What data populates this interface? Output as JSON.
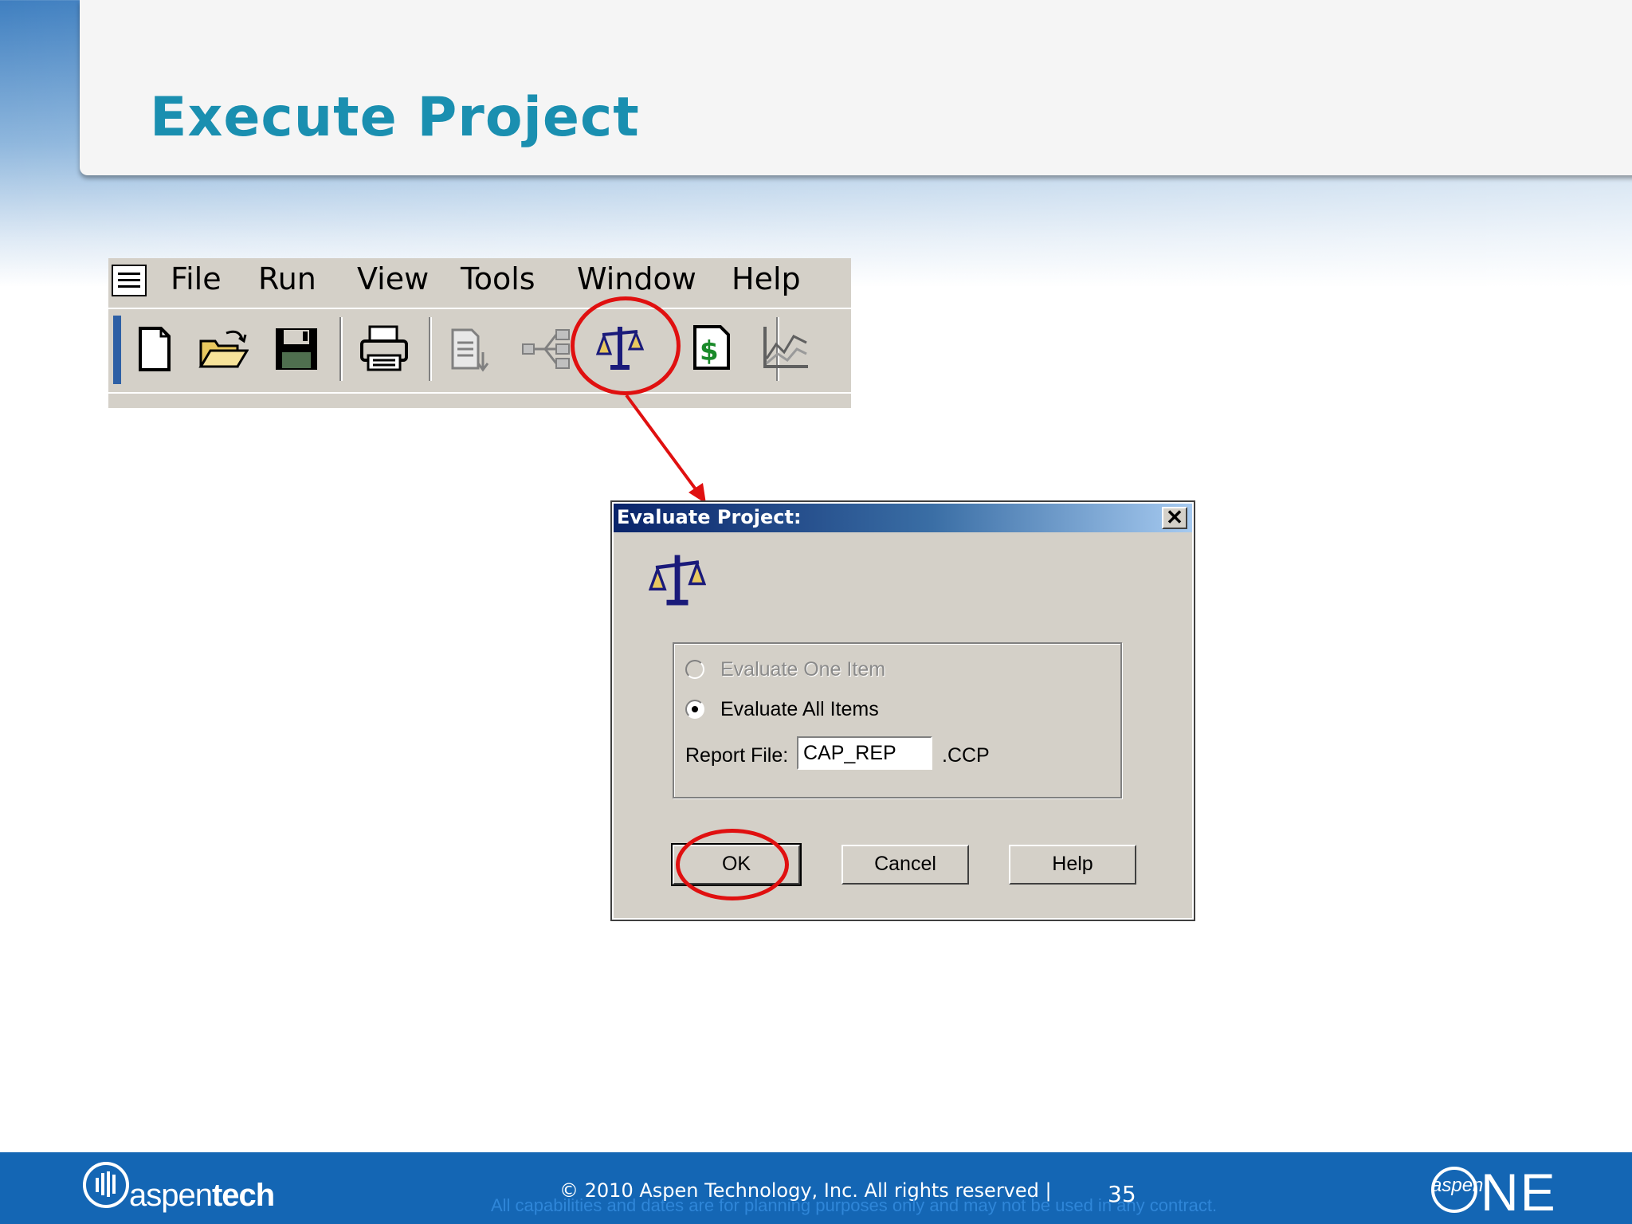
{
  "slide": {
    "title": "Execute Project"
  },
  "app_menu": {
    "items": [
      "File",
      "Run",
      "View",
      "Tools",
      "Window",
      "Help"
    ]
  },
  "toolbar": {
    "buttons": [
      "new-file-icon",
      "open-folder-icon",
      "save-icon",
      "print-icon",
      "report-icon",
      "tree-icon",
      "evaluate-scale-icon",
      "cost-dollar-icon",
      "chart-icon"
    ],
    "highlighted": "evaluate-scale-icon"
  },
  "dialog": {
    "title": "Evaluate Project:",
    "close_glyph": "✕",
    "options": [
      {
        "label": "Evaluate One Item",
        "enabled": false,
        "selected": false
      },
      {
        "label": "Evaluate All Items",
        "enabled": true,
        "selected": true
      }
    ],
    "report_file_label": "Report File:",
    "report_file_value": "CAP_REP",
    "report_file_ext": ".CCP",
    "buttons": {
      "ok": "OK",
      "cancel": "Cancel",
      "help": "Help"
    },
    "highlighted": "OK"
  },
  "footer": {
    "brand": {
      "light": "aspen",
      "bold": "tech"
    },
    "copyright": "© 2010 Aspen Technology, Inc. All rights reserved    |",
    "page_number": "35",
    "disclaimer": "All capabilities and dates are for planning purposes only and may not be used in any contract.",
    "product_logo": {
      "prefix": "aspen",
      "name": "NE"
    }
  },
  "colors": {
    "title": "#1a8fb0",
    "footer": "#1466b4",
    "highlight_ring": "#e01010",
    "dialog_face": "#d4d0c8"
  }
}
